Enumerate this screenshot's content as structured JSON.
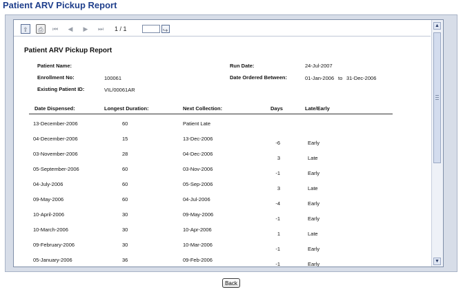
{
  "page": {
    "title": "Patient ARV Pickup Report"
  },
  "toolbar": {
    "page_count": "1 / 1",
    "page_input_value": ""
  },
  "report": {
    "title": "Patient ARV Pickup Report",
    "fields": {
      "patient_name_label": "Patient Name:",
      "patient_name_value": "",
      "enrollment_label": "Enrollment No:",
      "enrollment_value": "100061",
      "existing_id_label": "Existing Patient ID:",
      "existing_id_value": "VIL/00061AR",
      "run_date_label": "Run Date:",
      "run_date_value": "24-Jul-2007",
      "date_ordered_label": "Date Ordered Between:",
      "date_from": "01-Jan-2006",
      "date_to_word": "to",
      "date_to": "31-Dec-2006"
    },
    "columns": {
      "date_dispensed": "Date Dispensed:",
      "longest_duration": "Longest Duration:",
      "next_collection": "Next Collection:",
      "days": "Days",
      "late_early": "Late/Early"
    },
    "rows": [
      {
        "date": "13-December-2006",
        "duration": "60",
        "next": "Patient Late",
        "days": "",
        "status": ""
      },
      {
        "date": "04-December-2006",
        "duration": "15",
        "next": "13-Dec-2006",
        "days": "-6",
        "status": "Early"
      },
      {
        "date": "03-November-2006",
        "duration": "28",
        "next": "04-Dec-2006",
        "days": "3",
        "status": "Late"
      },
      {
        "date": "05-September-2006",
        "duration": "60",
        "next": "03-Nov-2006",
        "days": "-1",
        "status": "Early"
      },
      {
        "date": "04-July-2006",
        "duration": "60",
        "next": "05-Sep-2006",
        "days": "3",
        "status": "Late"
      },
      {
        "date": "09-May-2006",
        "duration": "60",
        "next": "04-Jul-2006",
        "days": "-4",
        "status": "Early"
      },
      {
        "date": "10-April-2006",
        "duration": "30",
        "next": "09-May-2006",
        "days": "-1",
        "status": "Early"
      },
      {
        "date": "10-March-2006",
        "duration": "30",
        "next": "10-Apr-2006",
        "days": "1",
        "status": "Late"
      },
      {
        "date": "09-February-2006",
        "duration": "30",
        "next": "10-Mar-2006",
        "days": "-1",
        "status": "Early"
      },
      {
        "date": "05-January-2006",
        "duration": "36",
        "next": "09-Feb-2006",
        "days": "-1",
        "status": "Early"
      }
    ]
  },
  "footer": {
    "back_label": "Back"
  }
}
